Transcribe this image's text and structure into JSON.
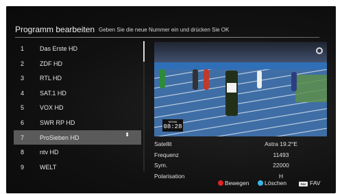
{
  "header": {
    "title": "Programm bearbeiten",
    "hint": "Geben Sie die neue Nummer ein und drücken Sie OK"
  },
  "channels": [
    {
      "num": "1",
      "name": "Das Erste HD"
    },
    {
      "num": "2",
      "name": "ZDF HD"
    },
    {
      "num": "3",
      "name": "RTL HD"
    },
    {
      "num": "4",
      "name": "SAT.1 HD"
    },
    {
      "num": "5",
      "name": "VOX HD"
    },
    {
      "num": "6",
      "name": "SWR RP HD"
    },
    {
      "num": "7",
      "name": "ProSieben HD"
    },
    {
      "num": "8",
      "name": "ntv HD"
    },
    {
      "num": "9",
      "name": "WELT"
    }
  ],
  "selected_channel_index": 6,
  "move_indicator": "⬍",
  "preview": {
    "clock_brand": "MOMA",
    "clock_time": "08:28"
  },
  "info": [
    {
      "label": "Satellit",
      "value": "Astra 19.2°E"
    },
    {
      "label": "Frequenz",
      "value": "11493"
    },
    {
      "label": "Sym.",
      "value": "22000"
    },
    {
      "label": "Polarisation",
      "value": "H"
    }
  ],
  "legend": {
    "move_label": "Bewegen",
    "move_color": "#e02323",
    "delete_label": "Löschen",
    "delete_color": "#38b6e8",
    "fav_key": "FAV",
    "fav_label": "FAV"
  },
  "colors": {
    "background": "#0d0d0d",
    "selected_row": "#5a5a5a"
  }
}
